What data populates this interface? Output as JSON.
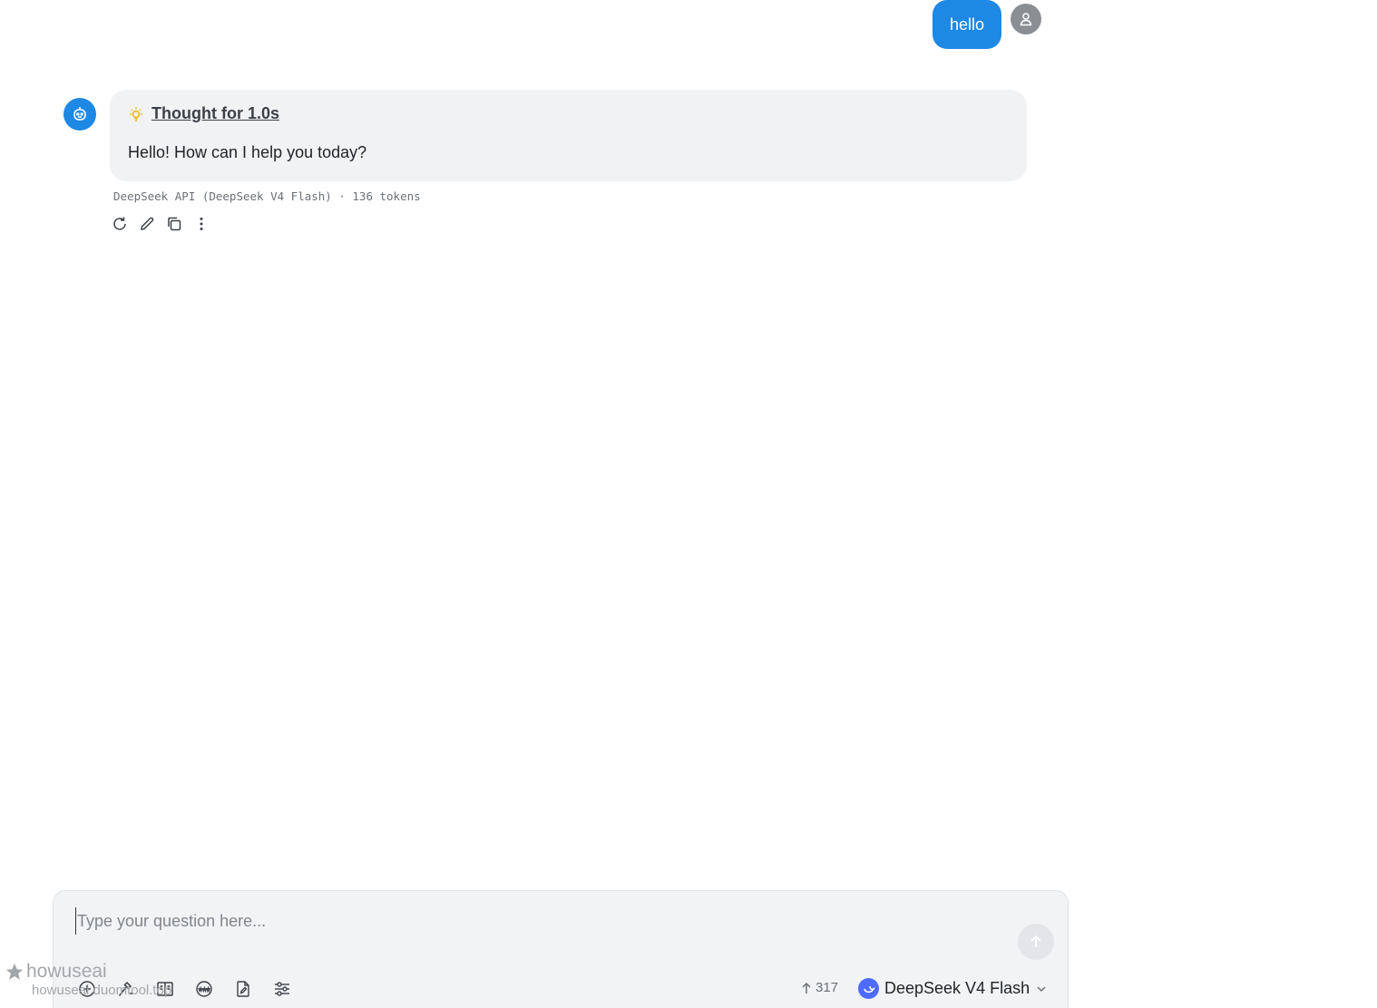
{
  "user_message": {
    "text": "hello"
  },
  "assistant_message": {
    "thought_label": "Thought for 1.0s",
    "text": "Hello! How can I help you today?",
    "meta": "DeepSeek API (DeepSeek V4 Flash) · 136 tokens"
  },
  "composer": {
    "placeholder": "Type your question here...",
    "token_count": "317",
    "model_name": "DeepSeek V4 Flash"
  },
  "watermark": {
    "title": "howuseai",
    "subtitle": "howuseai.duomtool.top"
  },
  "colors": {
    "accent": "#1e88e5",
    "bubble_bg": "#f1f2f4",
    "thought_icon": "#f5b100",
    "model_logo": "#4d6bfe"
  }
}
